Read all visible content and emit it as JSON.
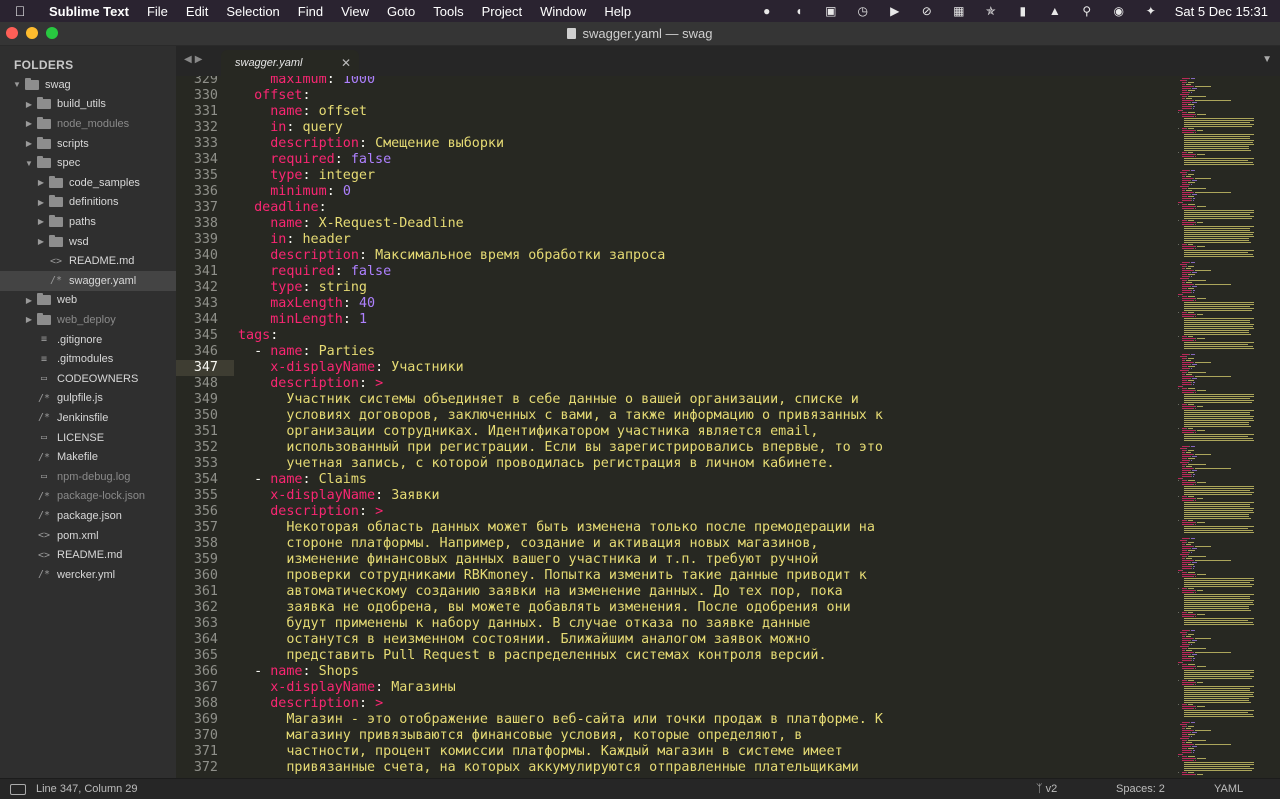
{
  "menubar": {
    "app_name": "Sublime Text",
    "items": [
      "File",
      "Edit",
      "Selection",
      "Find",
      "View",
      "Goto",
      "Tools",
      "Project",
      "Window",
      "Help"
    ],
    "clock": "Sat 5 Dec  15:31"
  },
  "window": {
    "title": "swagger.yaml — swag",
    "colors": {
      "close": "#fe5f57",
      "minimize": "#febc2e",
      "zoom": "#28c840"
    }
  },
  "sidebar": {
    "header": "FOLDERS",
    "items": [
      {
        "label": "swag",
        "type": "folder",
        "depth": 0,
        "expanded": true,
        "dim": false
      },
      {
        "label": "build_utils",
        "type": "folder",
        "depth": 1,
        "expanded": false,
        "dim": false
      },
      {
        "label": "node_modules",
        "type": "folder",
        "depth": 1,
        "expanded": false,
        "dim": true
      },
      {
        "label": "scripts",
        "type": "folder",
        "depth": 1,
        "expanded": false,
        "dim": false
      },
      {
        "label": "spec",
        "type": "folder",
        "depth": 1,
        "expanded": true,
        "dim": false
      },
      {
        "label": "code_samples",
        "type": "folder",
        "depth": 2,
        "expanded": false,
        "dim": false
      },
      {
        "label": "definitions",
        "type": "folder",
        "depth": 2,
        "expanded": false,
        "dim": false
      },
      {
        "label": "paths",
        "type": "folder",
        "depth": 2,
        "expanded": false,
        "dim": false
      },
      {
        "label": "wsd",
        "type": "folder",
        "depth": 2,
        "expanded": false,
        "dim": false
      },
      {
        "label": "README.md",
        "type": "file",
        "icon": "<>",
        "depth": 2,
        "dim": false
      },
      {
        "label": "swagger.yaml",
        "type": "file",
        "icon": "/*",
        "depth": 2,
        "dim": false,
        "selected": true
      },
      {
        "label": "web",
        "type": "folder",
        "depth": 1,
        "expanded": false,
        "dim": false
      },
      {
        "label": "web_deploy",
        "type": "folder",
        "depth": 1,
        "expanded": false,
        "dim": true
      },
      {
        "label": ".gitignore",
        "type": "file",
        "icon": "≡",
        "depth": 1,
        "dim": false
      },
      {
        "label": ".gitmodules",
        "type": "file",
        "icon": "≡",
        "depth": 1,
        "dim": false
      },
      {
        "label": "CODEOWNERS",
        "type": "file",
        "icon": "▭",
        "depth": 1,
        "dim": false
      },
      {
        "label": "gulpfile.js",
        "type": "file",
        "icon": "/*",
        "depth": 1,
        "dim": false
      },
      {
        "label": "Jenkinsfile",
        "type": "file",
        "icon": "/*",
        "depth": 1,
        "dim": false
      },
      {
        "label": "LICENSE",
        "type": "file",
        "icon": "▭",
        "depth": 1,
        "dim": false
      },
      {
        "label": "Makefile",
        "type": "file",
        "icon": "/*",
        "depth": 1,
        "dim": false
      },
      {
        "label": "npm-debug.log",
        "type": "file",
        "icon": "▭",
        "depth": 1,
        "dim": true
      },
      {
        "label": "package-lock.json",
        "type": "file",
        "icon": "/*",
        "depth": 1,
        "dim": true
      },
      {
        "label": "package.json",
        "type": "file",
        "icon": "/*",
        "depth": 1,
        "dim": false
      },
      {
        "label": "pom.xml",
        "type": "file",
        "icon": "<>",
        "depth": 1,
        "dim": false
      },
      {
        "label": "README.md",
        "type": "file",
        "icon": "<>",
        "depth": 1,
        "dim": false
      },
      {
        "label": "wercker.yml",
        "type": "file",
        "icon": "/*",
        "depth": 1,
        "dim": false
      }
    ]
  },
  "tabs": [
    {
      "label": "swagger.yaml",
      "active": true
    }
  ],
  "editor": {
    "active_line": 347,
    "lines": [
      {
        "n": "329",
        "tokens": [
          [
            "p",
            "    "
          ],
          [
            "k",
            "maximum"
          ],
          [
            "p",
            ": "
          ],
          [
            "n",
            "1000"
          ]
        ]
      },
      {
        "n": "330",
        "tokens": [
          [
            "p",
            "  "
          ],
          [
            "k",
            "offset"
          ],
          [
            "p",
            ":"
          ]
        ]
      },
      {
        "n": "331",
        "tokens": [
          [
            "p",
            "    "
          ],
          [
            "k",
            "name"
          ],
          [
            "p",
            ": "
          ],
          [
            "s",
            "offset"
          ]
        ]
      },
      {
        "n": "332",
        "tokens": [
          [
            "p",
            "    "
          ],
          [
            "k",
            "in"
          ],
          [
            "p",
            ": "
          ],
          [
            "s",
            "query"
          ]
        ]
      },
      {
        "n": "333",
        "tokens": [
          [
            "p",
            "    "
          ],
          [
            "k",
            "description"
          ],
          [
            "p",
            ": "
          ],
          [
            "s",
            "Смещение выборки"
          ]
        ]
      },
      {
        "n": "334",
        "tokens": [
          [
            "p",
            "    "
          ],
          [
            "k",
            "required"
          ],
          [
            "p",
            ": "
          ],
          [
            "n",
            "false"
          ]
        ]
      },
      {
        "n": "335",
        "tokens": [
          [
            "p",
            "    "
          ],
          [
            "k",
            "type"
          ],
          [
            "p",
            ": "
          ],
          [
            "s",
            "integer"
          ]
        ]
      },
      {
        "n": "336",
        "tokens": [
          [
            "p",
            "    "
          ],
          [
            "k",
            "minimum"
          ],
          [
            "p",
            ": "
          ],
          [
            "n",
            "0"
          ]
        ]
      },
      {
        "n": "337",
        "tokens": [
          [
            "p",
            "  "
          ],
          [
            "k",
            "deadline"
          ],
          [
            "p",
            ":"
          ]
        ]
      },
      {
        "n": "338",
        "tokens": [
          [
            "p",
            "    "
          ],
          [
            "k",
            "name"
          ],
          [
            "p",
            ": "
          ],
          [
            "s",
            "X-Request-Deadline"
          ]
        ]
      },
      {
        "n": "339",
        "tokens": [
          [
            "p",
            "    "
          ],
          [
            "k",
            "in"
          ],
          [
            "p",
            ": "
          ],
          [
            "s",
            "header"
          ]
        ]
      },
      {
        "n": "340",
        "tokens": [
          [
            "p",
            "    "
          ],
          [
            "k",
            "description"
          ],
          [
            "p",
            ": "
          ],
          [
            "s",
            "Максимальное время обработки запроса"
          ]
        ]
      },
      {
        "n": "341",
        "tokens": [
          [
            "p",
            "    "
          ],
          [
            "k",
            "required"
          ],
          [
            "p",
            ": "
          ],
          [
            "n",
            "false"
          ]
        ]
      },
      {
        "n": "342",
        "tokens": [
          [
            "p",
            "    "
          ],
          [
            "k",
            "type"
          ],
          [
            "p",
            ": "
          ],
          [
            "s",
            "string"
          ]
        ]
      },
      {
        "n": "343",
        "tokens": [
          [
            "p",
            "    "
          ],
          [
            "k",
            "maxLength"
          ],
          [
            "p",
            ": "
          ],
          [
            "n",
            "40"
          ]
        ]
      },
      {
        "n": "344",
        "tokens": [
          [
            "p",
            "    "
          ],
          [
            "k",
            "minLength"
          ],
          [
            "p",
            ": "
          ],
          [
            "n",
            "1"
          ]
        ]
      },
      {
        "n": "345",
        "tokens": [
          [
            "k",
            "tags"
          ],
          [
            "p",
            ":"
          ]
        ]
      },
      {
        "n": "346",
        "tokens": [
          [
            "p",
            "  - "
          ],
          [
            "k",
            "name"
          ],
          [
            "p",
            ": "
          ],
          [
            "s",
            "Parties"
          ]
        ]
      },
      {
        "n": "347",
        "tokens": [
          [
            "p",
            "    "
          ],
          [
            "k",
            "x-displayName"
          ],
          [
            "p",
            ": "
          ],
          [
            "s",
            "Участники"
          ]
        ]
      },
      {
        "n": "348",
        "tokens": [
          [
            "p",
            "    "
          ],
          [
            "k",
            "description"
          ],
          [
            "p",
            ": "
          ],
          [
            "k",
            ">"
          ]
        ]
      },
      {
        "n": "349",
        "tokens": [
          [
            "p",
            "      "
          ],
          [
            "s",
            "Участник системы объединяет в себе данные о вашей организации, списке и"
          ]
        ]
      },
      {
        "n": "350",
        "tokens": [
          [
            "p",
            "      "
          ],
          [
            "s",
            "условиях договоров, заключенных с вами, а также информацию о привязанных к"
          ]
        ]
      },
      {
        "n": "351",
        "tokens": [
          [
            "p",
            "      "
          ],
          [
            "s",
            "организации сотрудниках. Идентификатором участника является email,"
          ]
        ]
      },
      {
        "n": "352",
        "tokens": [
          [
            "p",
            "      "
          ],
          [
            "s",
            "использованный при регистрации. Если вы зарегистрировались впервые, то это"
          ]
        ]
      },
      {
        "n": "353",
        "tokens": [
          [
            "p",
            "      "
          ],
          [
            "s",
            "учетная запись, с которой проводилась регистрация в личном кабинете."
          ]
        ]
      },
      {
        "n": "354",
        "tokens": [
          [
            "p",
            "  - "
          ],
          [
            "k",
            "name"
          ],
          [
            "p",
            ": "
          ],
          [
            "s",
            "Claims"
          ]
        ]
      },
      {
        "n": "355",
        "tokens": [
          [
            "p",
            "    "
          ],
          [
            "k",
            "x-displayName"
          ],
          [
            "p",
            ": "
          ],
          [
            "s",
            "Заявки"
          ]
        ]
      },
      {
        "n": "356",
        "tokens": [
          [
            "p",
            "    "
          ],
          [
            "k",
            "description"
          ],
          [
            "p",
            ": "
          ],
          [
            "k",
            ">"
          ]
        ]
      },
      {
        "n": "357",
        "tokens": [
          [
            "p",
            "      "
          ],
          [
            "s",
            "Некоторая область данных может быть изменена только после премодерации на"
          ]
        ]
      },
      {
        "n": "358",
        "tokens": [
          [
            "p",
            "      "
          ],
          [
            "s",
            "стороне платформы. Например, создание и активация новых магазинов,"
          ]
        ]
      },
      {
        "n": "359",
        "tokens": [
          [
            "p",
            "      "
          ],
          [
            "s",
            "изменение финансовых данных вашего участника и т.п. требуют ручной"
          ]
        ]
      },
      {
        "n": "360",
        "tokens": [
          [
            "p",
            "      "
          ],
          [
            "s",
            "проверки сотрудниками RBKmoney. Попытка изменить такие данные приводит к"
          ]
        ]
      },
      {
        "n": "361",
        "tokens": [
          [
            "p",
            "      "
          ],
          [
            "s",
            "автоматическому созданию заявки на изменение данных. До тех пор, пока"
          ]
        ]
      },
      {
        "n": "362",
        "tokens": [
          [
            "p",
            "      "
          ],
          [
            "s",
            "заявка не одобрена, вы можете добавлять изменения. После одобрения они"
          ]
        ]
      },
      {
        "n": "363",
        "tokens": [
          [
            "p",
            "      "
          ],
          [
            "s",
            "будут применены к набору данных. В случае отказа по заявке данные"
          ]
        ]
      },
      {
        "n": "364",
        "tokens": [
          [
            "p",
            "      "
          ],
          [
            "s",
            "останутся в неизменном состоянии. Ближайшим аналогом заявок можно"
          ]
        ]
      },
      {
        "n": "365",
        "tokens": [
          [
            "p",
            "      "
          ],
          [
            "s",
            "представить Pull Request в распределенных системах контроля версий."
          ]
        ]
      },
      {
        "n": "366",
        "tokens": [
          [
            "p",
            "  - "
          ],
          [
            "k",
            "name"
          ],
          [
            "p",
            ": "
          ],
          [
            "s",
            "Shops"
          ]
        ]
      },
      {
        "n": "367",
        "tokens": [
          [
            "p",
            "    "
          ],
          [
            "k",
            "x-displayName"
          ],
          [
            "p",
            ": "
          ],
          [
            "s",
            "Магазины"
          ]
        ]
      },
      {
        "n": "368",
        "tokens": [
          [
            "p",
            "    "
          ],
          [
            "k",
            "description"
          ],
          [
            "p",
            ": "
          ],
          [
            "k",
            ">"
          ]
        ]
      },
      {
        "n": "369",
        "tokens": [
          [
            "p",
            "      "
          ],
          [
            "s",
            "Магазин - это отображение вашего веб-сайта или точки продаж в платформе. К"
          ]
        ]
      },
      {
        "n": "370",
        "tokens": [
          [
            "p",
            "      "
          ],
          [
            "s",
            "магазину привязываются финансовые условия, которые определяют, в"
          ]
        ]
      },
      {
        "n": "371",
        "tokens": [
          [
            "p",
            "      "
          ],
          [
            "s",
            "частности, процент комиссии платформы. Каждый магазин в системе имеет"
          ]
        ]
      },
      {
        "n": "372",
        "tokens": [
          [
            "p",
            "      "
          ],
          [
            "s",
            "привязанные счета, на которых аккумулируются отправленные плательщиками"
          ]
        ]
      }
    ]
  },
  "statusbar": {
    "position": "Line 347, Column 29",
    "branch": "v2",
    "spaces": "Spaces: 2",
    "syntax": "YAML"
  },
  "theme": {
    "keyword": "#f92672",
    "string": "#e6db74",
    "number": "#ae81ff",
    "background": "#272822"
  }
}
